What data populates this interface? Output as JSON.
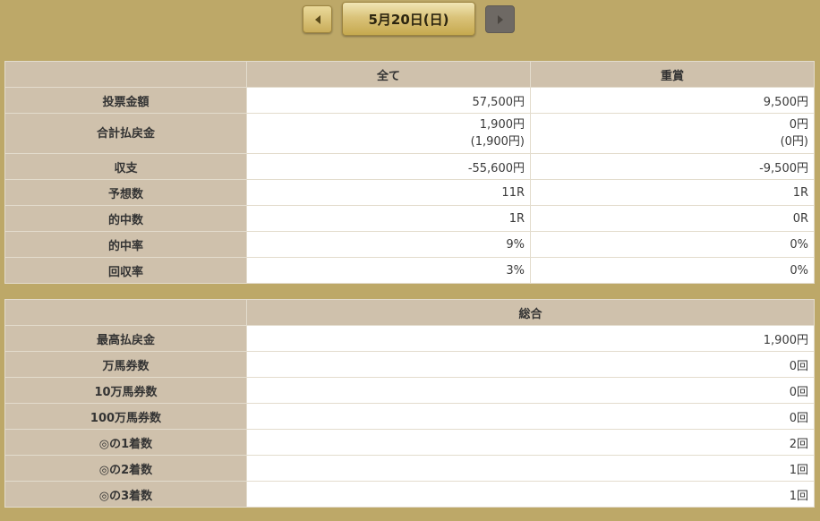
{
  "date_nav": {
    "date_label": "5月20日(日)",
    "prev_icon": "triangle-left-icon",
    "next_icon": "triangle-right-icon"
  },
  "summary": {
    "headers": [
      "",
      "全て",
      "重賞"
    ],
    "rows": [
      {
        "label": "投票金額",
        "all": "57,500円",
        "graded": "9,500円"
      },
      {
        "label": "合計払戻金",
        "all": "1,900円",
        "all_sub": "(1,900円)",
        "graded": "0円",
        "graded_sub": "(0円)"
      },
      {
        "label": "収支",
        "all": "-55,600円",
        "graded": "-9,500円"
      },
      {
        "label": "予想数",
        "all": "11R",
        "graded": "1R"
      },
      {
        "label": "的中数",
        "all": "1R",
        "graded": "0R"
      },
      {
        "label": "的中率",
        "all": "9%",
        "graded": "0%"
      },
      {
        "label": "回収率",
        "all": "3%",
        "graded": "0%"
      }
    ]
  },
  "totals": {
    "header": "総合",
    "rows": [
      {
        "label": "最高払戻金",
        "value": "1,900円"
      },
      {
        "label": "万馬券数",
        "value": "0回"
      },
      {
        "label": "10万馬券数",
        "value": "0回"
      },
      {
        "label": "100万馬券数",
        "value": "0回"
      },
      {
        "label": "◎の1着数",
        "value": "2回"
      },
      {
        "label": "◎の2着数",
        "value": "1回"
      },
      {
        "label": "◎の3着数",
        "value": "1回"
      }
    ]
  },
  "colors": {
    "background": "#bda868",
    "header_cell": "#cfc1ac",
    "accent_gold": "#dac37a",
    "next_button": "#6e6964"
  }
}
